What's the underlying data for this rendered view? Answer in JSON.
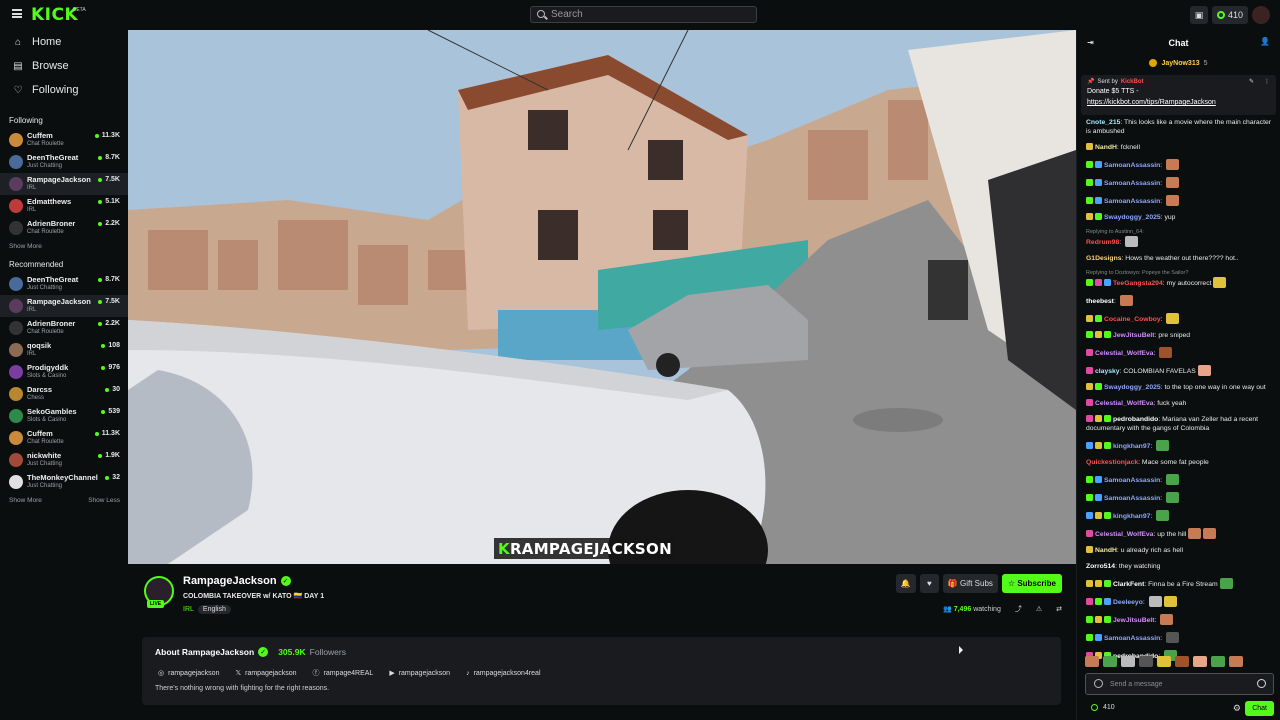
{
  "topbar": {
    "logo": "KICK",
    "logo_badge": "BETA",
    "search_placeholder": "Search",
    "points": "410"
  },
  "nav": [
    {
      "label": "Home",
      "icon": "home-icon"
    },
    {
      "label": "Browse",
      "icon": "browse-icon"
    },
    {
      "label": "Following",
      "icon": "heart-icon"
    }
  ],
  "following": {
    "title": "Following",
    "channels": [
      {
        "name": "Cuffem",
        "category": "Chat Roulette",
        "viewers": "11.3K",
        "color": "#c98a3c"
      },
      {
        "name": "DeenTheGreat",
        "category": "Just Chatting",
        "viewers": "8.7K",
        "color": "#4a6a9a"
      },
      {
        "name": "RampageJackson",
        "category": "IRL",
        "viewers": "7.5K",
        "color": "#5b3c5e"
      },
      {
        "name": "Edmatthews",
        "category": "IRL",
        "viewers": "5.1K",
        "color": "#bd3b3b"
      },
      {
        "name": "AdrienBroner",
        "category": "Chat Roulette",
        "viewers": "2.2K",
        "color": "#333333"
      }
    ],
    "show_more": "Show More"
  },
  "recommended": {
    "title": "Recommended",
    "channels": [
      {
        "name": "DeenTheGreat",
        "category": "Just Chatting",
        "viewers": "8.7K",
        "color": "#4a6a9a"
      },
      {
        "name": "RampageJackson",
        "category": "IRL",
        "viewers": "7.5K",
        "color": "#5b3c5e"
      },
      {
        "name": "AdrienBroner",
        "category": "Chat Roulette",
        "viewers": "2.2K",
        "color": "#333333"
      },
      {
        "name": "qoqsik",
        "category": "IRL",
        "viewers": "108",
        "color": "#8c6b55"
      },
      {
        "name": "Prodigyddk",
        "category": "Slots & Casino",
        "viewers": "976",
        "color": "#7a3ea1"
      },
      {
        "name": "Darcss",
        "category": "Chess",
        "viewers": "30",
        "color": "#b8872f"
      },
      {
        "name": "SekoGambles",
        "category": "Slots & Casino",
        "viewers": "539",
        "color": "#2e8a4a"
      },
      {
        "name": "Cuffem",
        "category": "Chat Roulette",
        "viewers": "11.3K",
        "color": "#c98a3c"
      },
      {
        "name": "nickwhite",
        "category": "Just Chatting",
        "viewers": "1.9K",
        "color": "#a04a3a"
      },
      {
        "name": "TheMonkeyChannel",
        "category": "Just Chatting",
        "viewers": "32",
        "color": "#e0e0e0"
      }
    ],
    "show_more": "Show More",
    "show_less": "Show Less"
  },
  "video": {
    "watermark_k": "K",
    "watermark_rest": "RAMPAGEJACKSON"
  },
  "stream": {
    "name": "RampageJackson",
    "live": "LIVE",
    "title": "COLOMBIA TAKEOVER w/ KATO 🇨🇴 DAY 1",
    "category": "IRL",
    "tag": "English",
    "gift_subs": "Gift Subs",
    "subscribe": "Subscribe",
    "watching_count": "7,496",
    "watching_label": "watching"
  },
  "about": {
    "title": "About RampageJackson",
    "followers_count": "305.9K",
    "followers_label": "Followers",
    "socials": [
      {
        "icon": "instagram-icon",
        "glyph": "◎",
        "handle": "rampagejackson"
      },
      {
        "icon": "x-icon",
        "glyph": "𝕏",
        "handle": "rampagejackson"
      },
      {
        "icon": "facebook-icon",
        "glyph": "ⓕ",
        "handle": "rampage4REAL"
      },
      {
        "icon": "youtube-icon",
        "glyph": "▶",
        "handle": "rampagejackson"
      },
      {
        "icon": "tiktok-icon",
        "glyph": "♪",
        "handle": "rampagejackson4real"
      }
    ],
    "bio": "There's nothing wrong with fighting for the right reasons."
  },
  "chat": {
    "title": "Chat",
    "gifter": "JayNow313",
    "gifter_count": "5",
    "pinned_sent_by": "Sent by",
    "pinned_user": "KickBot",
    "pinned_text": "Donate $5 TTS -",
    "pinned_link": "https://kickbot.com/tips/RampageJackson",
    "messages": [
      {
        "user": "Cnote_215",
        "color": "#a7e7ff",
        "text": "This looks like a movie where the main character is ambushed",
        "badges": [],
        "emotes": []
      },
      {
        "user": "NandH",
        "color": "#f3e9a1",
        "text": "fcknell",
        "badges": [
          "#e0c13a"
        ],
        "emotes": []
      },
      {
        "user": "SamoanAssassin",
        "color": "#8fa6ff",
        "text": "",
        "badges": [
          "#53fc18",
          "#4aa3ff"
        ],
        "emotes": [
          "#c77b55"
        ]
      },
      {
        "user": "SamoanAssassin",
        "color": "#8fa6ff",
        "text": "",
        "badges": [
          "#53fc18",
          "#4aa3ff"
        ],
        "emotes": [
          "#c77b55"
        ]
      },
      {
        "user": "SamoanAssassin",
        "color": "#8fa6ff",
        "text": "",
        "badges": [
          "#53fc18",
          "#4aa3ff"
        ],
        "emotes": [
          "#c77b55"
        ]
      },
      {
        "user": "Swaydoggy_2025",
        "color": "#8fa6ff",
        "text": "yup",
        "badges": [
          "#e0c13a",
          "#53fc18"
        ],
        "emotes": []
      },
      {
        "reply": "Replying to Austinn_64:"
      },
      {
        "user": "Redrum98",
        "color": "#ff4f4f",
        "text": "",
        "badges": [],
        "emotes": [
          "#bbbbbb"
        ]
      },
      {
        "user": "G1Designs",
        "color": "#ffd36b",
        "text": "Hows the weather out there???? hot..",
        "badges": [],
        "emotes": []
      },
      {
        "reply": "Replying to Dozlowyo: Popeye the Sailor?"
      },
      {
        "user": "TeeGangsta294",
        "color": "#ff4f4f",
        "text": "my autocorrect",
        "badges": [
          "#53fc18",
          "#e04aa0",
          "#4aa3ff"
        ],
        "emotes": [
          "#e0c13a"
        ]
      },
      {
        "user": "theebest",
        "color": "#ffffff",
        "text": "",
        "badges": [],
        "emotes": [
          "#c77b55"
        ]
      },
      {
        "user": "Cocaine_Cowboy",
        "color": "#ff4f4f",
        "text": "",
        "badges": [
          "#e0c13a",
          "#53fc18"
        ],
        "emotes": [
          "#e0c13a"
        ]
      },
      {
        "user": "JewJitsuBelt",
        "color": "#d38cff",
        "text": "pre sniped",
        "badges": [
          "#53fc18",
          "#e0c13a",
          "#53fc18"
        ],
        "emotes": []
      },
      {
        "user": "Celestial_WolfEva",
        "color": "#d38cff",
        "text": "",
        "badges": [
          "#e04aa0"
        ],
        "emotes": [
          "#a0522d"
        ]
      },
      {
        "user": "claysky",
        "color": "#a7e7ff",
        "text": "COLOMBIAN FAVELAS",
        "badges": [
          "#e04aa0"
        ],
        "emotes": [
          "#e8a58a"
        ]
      },
      {
        "user": "Swaydoggy_2025",
        "color": "#8fa6ff",
        "text": "to the top one way in one way out",
        "badges": [
          "#e0c13a",
          "#53fc18"
        ],
        "emotes": []
      },
      {
        "user": "Celestial_WolfEva",
        "color": "#d38cff",
        "text": "fuck yeah",
        "badges": [
          "#e04aa0"
        ],
        "emotes": []
      },
      {
        "user": "pedrobandido",
        "color": "#ffffff",
        "text": "Mariana van Zeller had a recent documentary with the gangs of Colombia",
        "badges": [
          "#e04aa0",
          "#e0c13a",
          "#53fc18"
        ],
        "emotes": []
      },
      {
        "user": "kingkhan97",
        "color": "#8fa6ff",
        "text": "",
        "badges": [
          "#4aa3ff",
          "#e0c13a",
          "#53fc18"
        ],
        "emotes": [
          "#4aa34a"
        ]
      },
      {
        "user": "Quickestionjack",
        "color": "#ff4f4f",
        "text": "Mace some fat people",
        "badges": [],
        "emotes": []
      },
      {
        "user": "SamoanAssassin",
        "color": "#8fa6ff",
        "text": "",
        "badges": [
          "#53fc18",
          "#4aa3ff"
        ],
        "emotes": [
          "#4aa34a"
        ]
      },
      {
        "user": "SamoanAssassin",
        "color": "#8fa6ff",
        "text": "",
        "badges": [
          "#53fc18",
          "#4aa3ff"
        ],
        "emotes": [
          "#4aa34a"
        ]
      },
      {
        "user": "kingkhan97",
        "color": "#8fa6ff",
        "text": "",
        "badges": [
          "#4aa3ff",
          "#e0c13a",
          "#53fc18"
        ],
        "emotes": [
          "#4aa34a"
        ]
      },
      {
        "user": "Celestial_WolfEva",
        "color": "#d38cff",
        "text": "up the hill",
        "badges": [
          "#e04aa0"
        ],
        "emotes": [
          "#c77b55",
          "#c77b55"
        ]
      },
      {
        "user": "NandH",
        "color": "#f3e9a1",
        "text": "u already rich as hell",
        "badges": [
          "#e0c13a"
        ],
        "emotes": []
      },
      {
        "user": "Zorro514",
        "color": "#ffffff",
        "text": "they watching",
        "badges": [],
        "emotes": []
      },
      {
        "user": "ClarkFent",
        "color": "#ffffff",
        "text": "Finna be a Fire Stream",
        "badges": [
          "#e0c13a",
          "#e0c13a",
          "#53fc18"
        ],
        "emotes": [
          "#4aa34a"
        ]
      },
      {
        "user": "Deeleeyo",
        "color": "#8fa6ff",
        "text": "",
        "badges": [
          "#e04aa0",
          "#53fc18",
          "#4aa3ff"
        ],
        "emotes": [
          "#bbbbbb",
          "#e0c13a"
        ]
      },
      {
        "user": "JewJitsuBelt",
        "color": "#d38cff",
        "text": "",
        "badges": [
          "#53fc18",
          "#e0c13a",
          "#53fc18"
        ],
        "emotes": [
          "#c77b55"
        ]
      },
      {
        "user": "SamoanAssassin",
        "color": "#8fa6ff",
        "text": "",
        "badges": [
          "#53fc18",
          "#4aa3ff"
        ],
        "emotes": [
          "#555555"
        ]
      },
      {
        "user": "pedrobandido",
        "color": "#ffffff",
        "text": "",
        "badges": [
          "#e04aa0",
          "#e0c13a",
          "#53fc18"
        ],
        "emotes": [
          "#4aa34a"
        ]
      }
    ],
    "input_placeholder": "Send a message",
    "points": "410",
    "send_label": "Chat"
  },
  "colors": {
    "accent": "#53fc18",
    "bg": "#0b0e0f",
    "panel": "#191b1f"
  }
}
